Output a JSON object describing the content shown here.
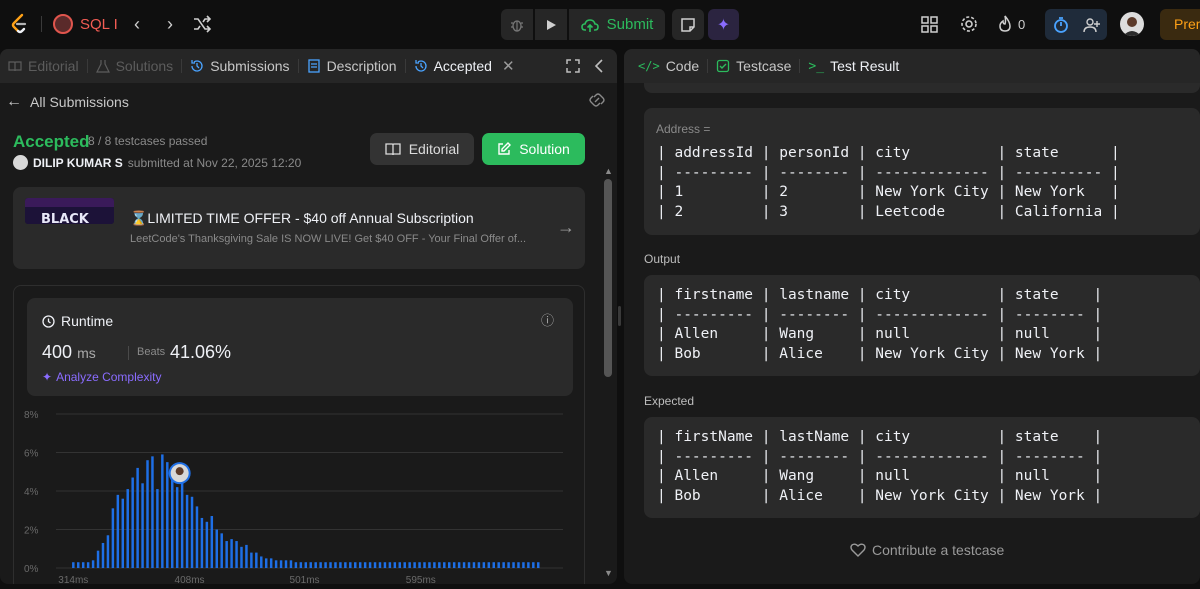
{
  "topbar": {
    "problem_name": "SQL I",
    "submit_label": "Submit",
    "fire_count": "0",
    "premium_label": "Premium"
  },
  "left_tabs": [
    {
      "label": "Editorial"
    },
    {
      "label": "Solutions"
    },
    {
      "label": "Submissions"
    },
    {
      "label": "Description"
    },
    {
      "label": "Accepted"
    }
  ],
  "submission": {
    "back_label": "All Submissions",
    "status": "Accepted",
    "testcases": "8 / 8 testcases passed",
    "user": "DILIP KUMAR S",
    "submitted_text": "submitted at Nov 22, 2025 12:20",
    "editorial_btn": "Editorial",
    "solution_btn": "Solution"
  },
  "promo": {
    "title": "⌛LIMITED TIME OFFER - $40 off Annual Subscription",
    "desc": "LeetCode's Thanksgiving Sale IS NOW LIVE! Get $40 OFF - Your Final Offer of..."
  },
  "runtime": {
    "label": "Runtime",
    "value": "400",
    "unit": "ms",
    "beats_label": "Beats",
    "beats_value": "41.06%",
    "analyze_label": "Analyze Complexity"
  },
  "chart_data": {
    "type": "bar",
    "y_ticks": [
      "8%",
      "6%",
      "4%",
      "2%",
      "0%"
    ],
    "x_ticks": [
      "314ms",
      "408ms",
      "501ms",
      "595ms"
    ],
    "ylim": [
      0,
      8
    ],
    "xlim": [
      300,
      710
    ],
    "marker_x": 400,
    "x": [
      314,
      318,
      322,
      326,
      330,
      334,
      338,
      342,
      346,
      350,
      354,
      358,
      362,
      366,
      370,
      374,
      378,
      382,
      386,
      390,
      394,
      398,
      402,
      406,
      410,
      414,
      418,
      422,
      426,
      430,
      434,
      438,
      442,
      446,
      450,
      454,
      458,
      462,
      466,
      470,
      474,
      478,
      482,
      486,
      490,
      494,
      498,
      502,
      506,
      510,
      514,
      518,
      522,
      526,
      530,
      534,
      538,
      542,
      546,
      550,
      554,
      558,
      562,
      566,
      570,
      574,
      578,
      582,
      586,
      590,
      594,
      598,
      602,
      606,
      610,
      614,
      618,
      622,
      626,
      630,
      634,
      638,
      642,
      646,
      650,
      654,
      658,
      662,
      666,
      670,
      674,
      678,
      682,
      686,
      690
    ],
    "values": [
      0.3,
      0.3,
      0.3,
      0.3,
      0.4,
      0.9,
      1.3,
      1.7,
      3.1,
      3.8,
      3.6,
      4.1,
      4.7,
      5.2,
      4.4,
      5.6,
      5.8,
      4.1,
      5.9,
      5.5,
      5.0,
      4.2,
      4.8,
      3.8,
      3.7,
      3.2,
      2.6,
      2.4,
      2.7,
      2.0,
      1.8,
      1.4,
      1.5,
      1.4,
      1.1,
      1.2,
      0.8,
      0.8,
      0.6,
      0.5,
      0.5,
      0.4,
      0.4,
      0.4,
      0.4,
      0.3,
      0.3,
      0.3,
      0.3,
      0.3,
      0.3,
      0.3,
      0.3,
      0.3,
      0.3,
      0.3,
      0.3,
      0.3,
      0.3,
      0.3,
      0.3,
      0.3,
      0.3,
      0.3,
      0.3,
      0.3,
      0.3,
      0.3,
      0.3,
      0.3,
      0.3,
      0.3,
      0.3,
      0.3,
      0.3,
      0.3,
      0.3,
      0.3,
      0.3,
      0.3,
      0.3,
      0.3,
      0.3,
      0.3,
      0.3,
      0.3,
      0.3,
      0.3,
      0.3,
      0.3,
      0.3,
      0.3,
      0.3,
      0.3,
      0.3
    ],
    "grid": true,
    "bar_color": "#1e6fe6"
  },
  "right_tabs": [
    {
      "label": "Code"
    },
    {
      "label": "Testcase"
    },
    {
      "label": "Test Result"
    }
  ],
  "result": {
    "partial_top_line": "|           |           |              |",
    "address_label": "Address =",
    "address_table": "| addressId | personId | city          | state      |\n| --------- | -------- | ------------- | ---------- |\n| 1         | 2        | New York City | New York   |\n| 2         | 3        | Leetcode      | California |",
    "output_label": "Output",
    "output_table": "| firstname | lastname | city          | state    |\n| --------- | -------- | ------------- | -------- |\n| Allen     | Wang     | null          | null     |\n| Bob       | Alice    | New York City | New York |",
    "expected_label": "Expected",
    "expected_table": "| firstName | lastName | city          | state    |\n| --------- | -------- | ------------- | -------- |\n| Allen     | Wang     | null          | null     |\n| Bob       | Alice    | New York City | New York |",
    "contribute_label": "Contribute a testcase"
  }
}
